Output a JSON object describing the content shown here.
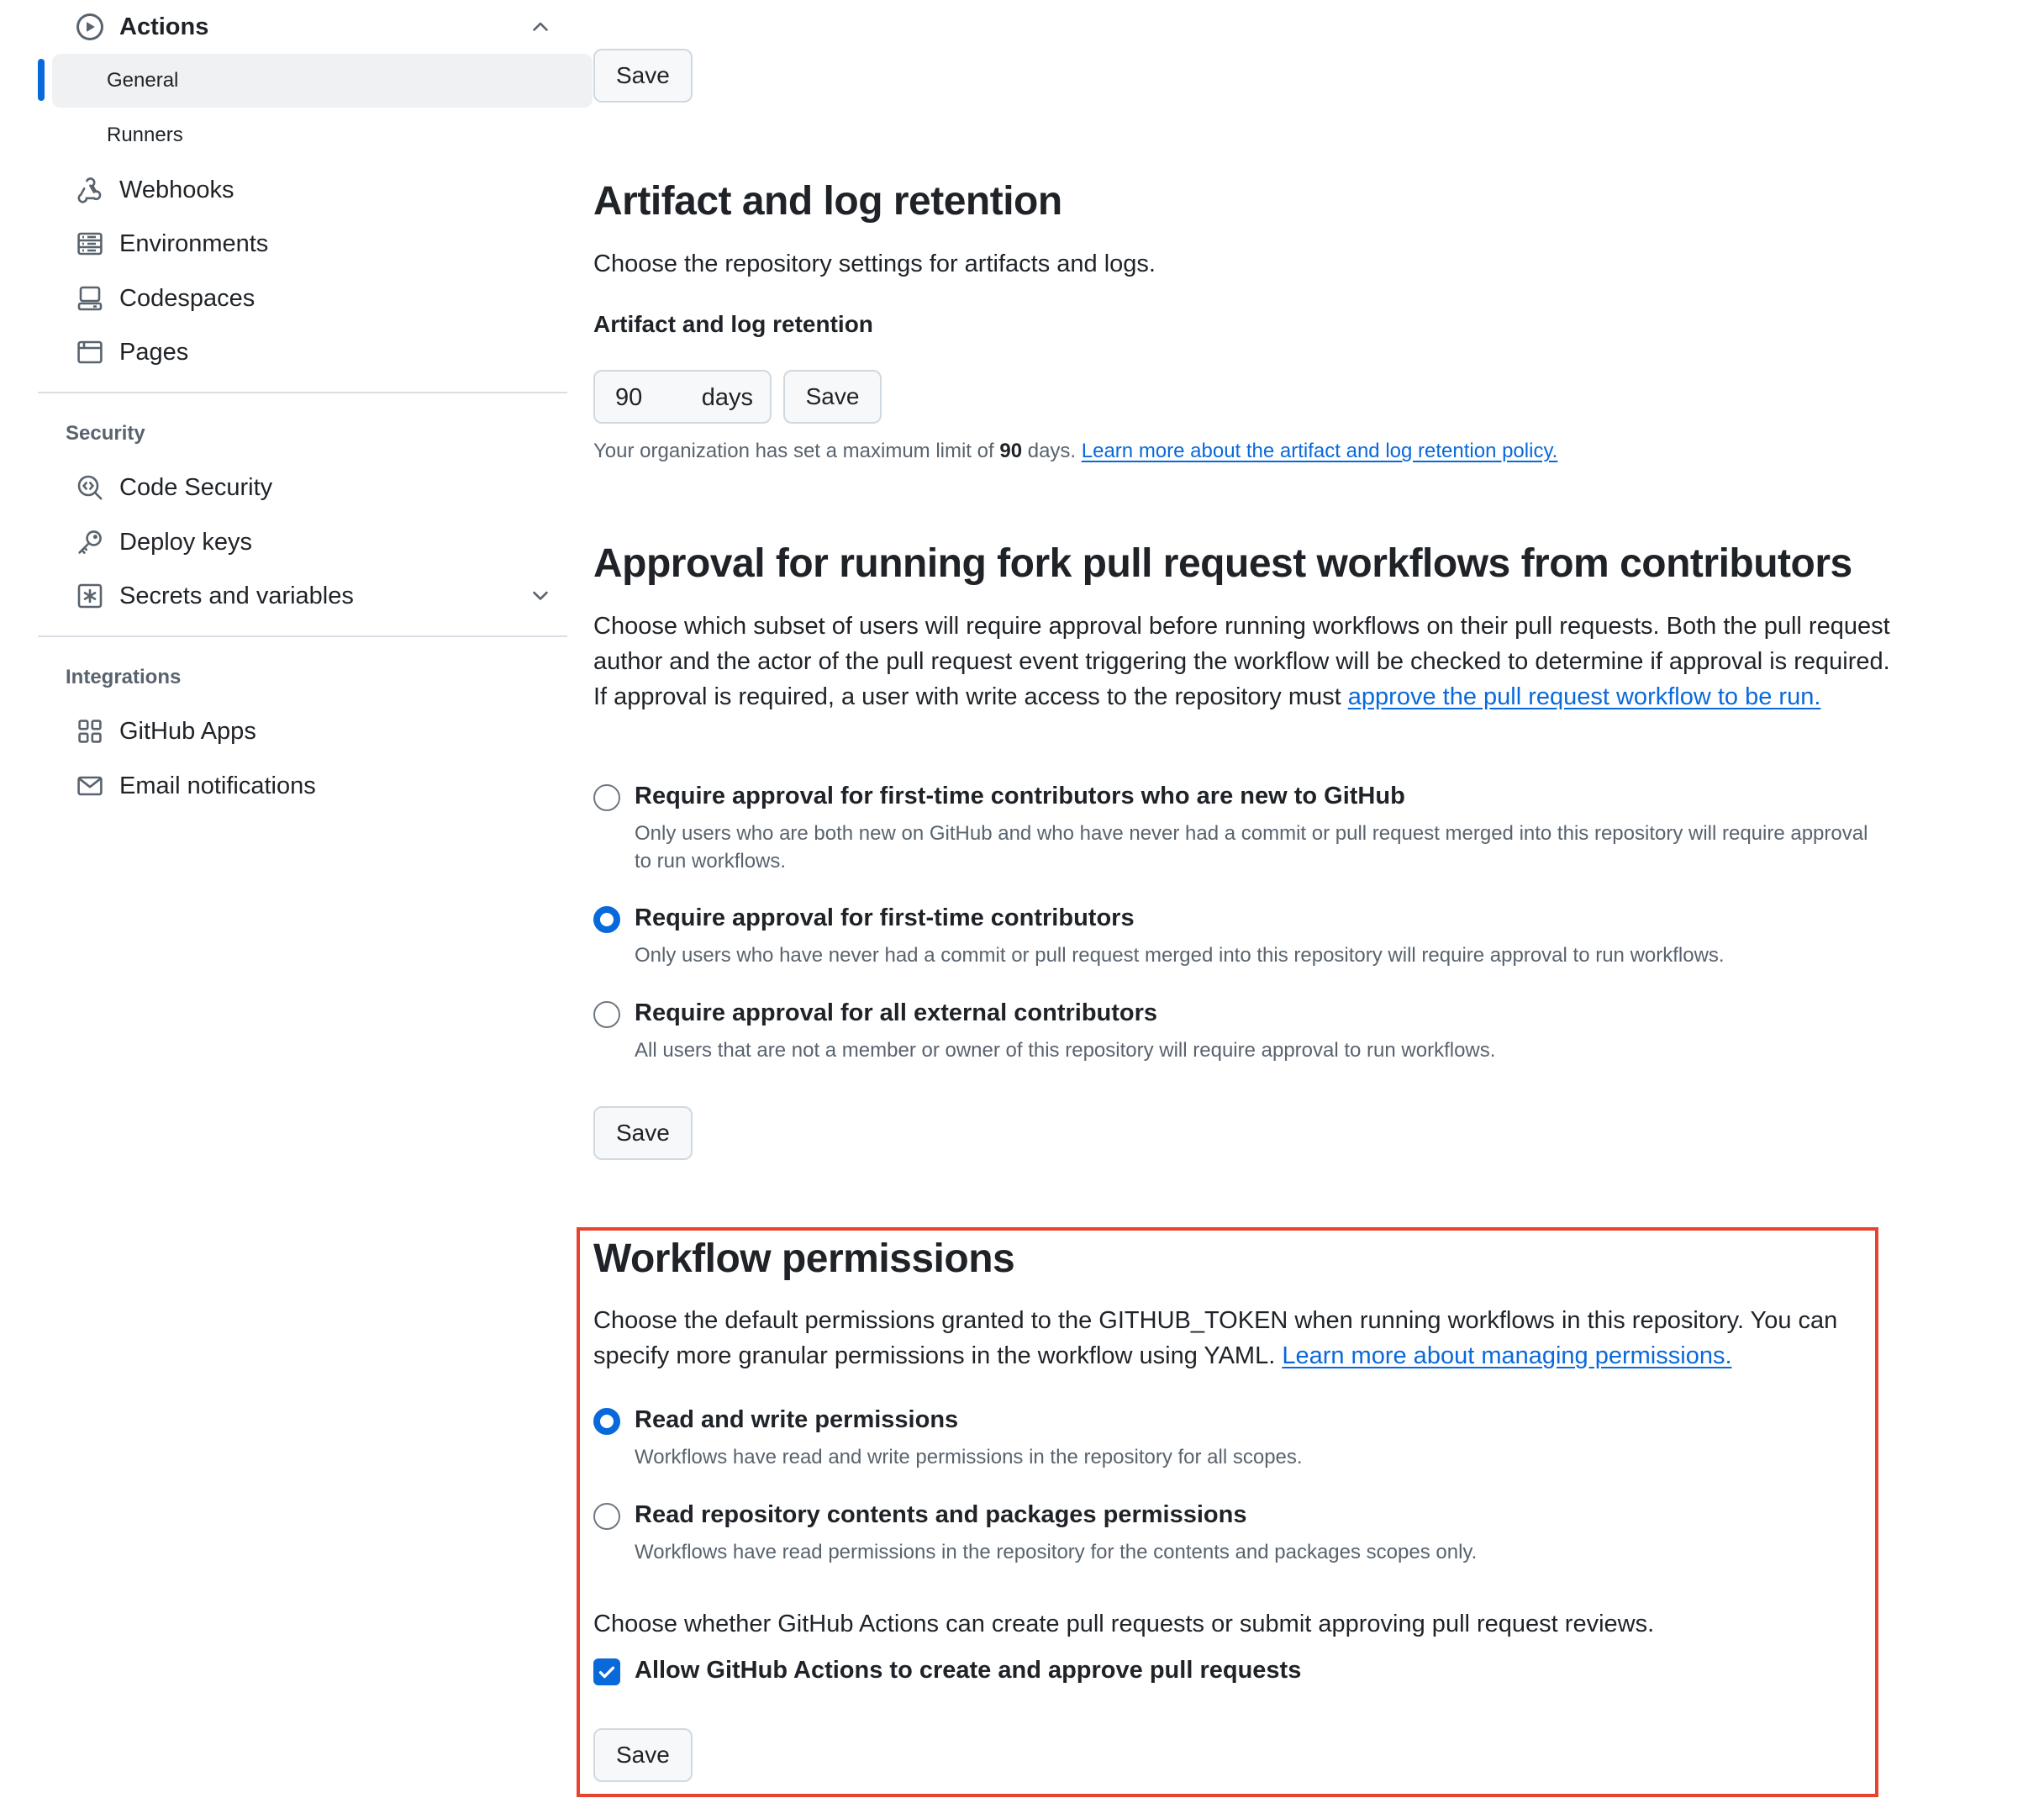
{
  "sidebar": {
    "actions": {
      "label": "Actions",
      "icon": "play-circle-icon"
    },
    "actions_children": [
      {
        "label": "General",
        "active": true
      },
      {
        "label": "Runners"
      }
    ],
    "items": [
      {
        "label": "Webhooks",
        "icon": "webhook-icon"
      },
      {
        "label": "Environments",
        "icon": "server-icon"
      },
      {
        "label": "Codespaces",
        "icon": "codespaces-icon"
      },
      {
        "label": "Pages",
        "icon": "browser-icon"
      }
    ],
    "security_heading": "Security",
    "security_items": [
      {
        "label": "Code Security",
        "icon": "codescan-icon"
      },
      {
        "label": "Deploy keys",
        "icon": "key-icon"
      },
      {
        "label": "Secrets and variables",
        "icon": "key-asterisk-icon"
      }
    ],
    "integrations_heading": "Integrations",
    "integration_items": [
      {
        "label": "GitHub Apps",
        "icon": "apps-icon"
      },
      {
        "label": "Email notifications",
        "icon": "mail-icon"
      }
    ]
  },
  "main": {
    "top_save": "Save",
    "retention": {
      "title": "Artifact and log retention",
      "description": "Choose the repository settings for artifacts and logs.",
      "field_label": "Artifact and log retention",
      "days_value": "90",
      "days_unit": "days",
      "save": "Save",
      "note_prefix": "Your organization has set a maximum limit of",
      "note_bold": "90",
      "note_suffix": "days.",
      "note_link": "Learn more about the artifact and log retention policy."
    },
    "approval": {
      "title": "Approval for running fork pull request workflows from contributors",
      "description": "Choose which subset of users will require approval before running workflows on their pull requests. Both the pull request author and the actor of the pull request event triggering the workflow will be checked to determine if approval is required. If approval is required, a user with write access to the repository must",
      "description_link": "approve the pull request workflow to be run.",
      "options": [
        {
          "label": "Require approval for first-time contributors who are new to GitHub",
          "description": "Only users who are both new on GitHub and who have never had a commit or pull request merged into this repository will require approval to run workflows.",
          "checked": false
        },
        {
          "label": "Require approval for first-time contributors",
          "description": "Only users who have never had a commit or pull request merged into this repository will require approval to run workflows.",
          "checked": true
        },
        {
          "label": "Require approval for all external contributors",
          "description": "All users that are not a member or owner of this repository will require approval to run workflows.",
          "checked": false
        }
      ],
      "save": "Save"
    },
    "workflow": {
      "title": "Workflow permissions",
      "description": "Choose the default permissions granted to the GITHUB_TOKEN when running workflows in this repository. You can specify more granular permissions in the workflow using YAML.",
      "description_link": "Learn more about managing permissions.",
      "options": [
        {
          "label": "Read and write permissions",
          "description": "Workflows have read and write permissions in the repository for all scopes.",
          "checked": true
        },
        {
          "label": "Read repository contents and packages permissions",
          "description": "Workflows have read permissions in the repository for the contents and packages scopes only.",
          "checked": false
        }
      ],
      "pr_text": "Choose whether GitHub Actions can create pull requests or submit approving pull request reviews.",
      "checkbox_label": "Allow GitHub Actions to create and approve pull requests",
      "checkbox_checked": true,
      "save": "Save"
    }
  },
  "colors": {
    "accent": "#0969da",
    "highlight": "#e8432f",
    "muted_text": "#59636e"
  }
}
